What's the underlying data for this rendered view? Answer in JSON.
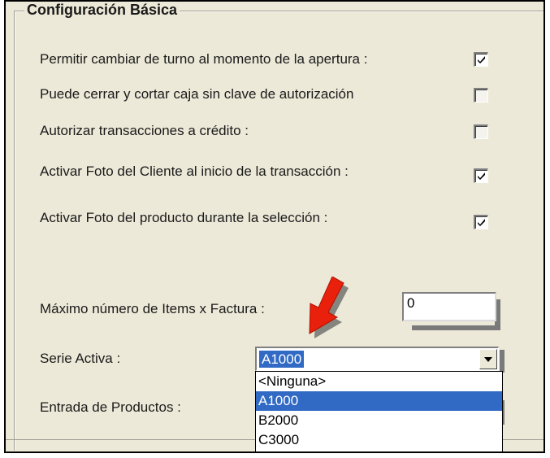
{
  "group": {
    "title": "Configuración Básica"
  },
  "options": [
    {
      "label": "Permitir cambiar de turno al momento de la apertura :",
      "checked": true,
      "enabled": true
    },
    {
      "label": "Puede cerrar y cortar caja sin clave de autorización",
      "checked": false,
      "enabled": false
    },
    {
      "label": "Autorizar transacciones a crédito :",
      "checked": false,
      "enabled": false
    },
    {
      "label": "Activar Foto del Cliente al inicio de la transacción :",
      "checked": true,
      "enabled": true
    },
    {
      "label": "Activar Foto del producto durante la selección :",
      "checked": true,
      "enabled": true
    }
  ],
  "max_items": {
    "label": "Máximo número de Items x Factura :",
    "value": "0"
  },
  "serie": {
    "label": "Serie Activa :",
    "value": "A1000",
    "options": [
      "<Ninguna>",
      "A1000",
      "B2000",
      "C3000"
    ],
    "selected_option": "A1000"
  },
  "entrada": {
    "label": "Entrada de Productos :"
  },
  "colors": {
    "selection": "#316ac5",
    "arrow": "#e8200c",
    "background": "#ece9d8"
  },
  "icons": {
    "checkmark": "check-icon",
    "dropdown": "chevron-down-icon",
    "annotation": "red-arrow-icon"
  }
}
